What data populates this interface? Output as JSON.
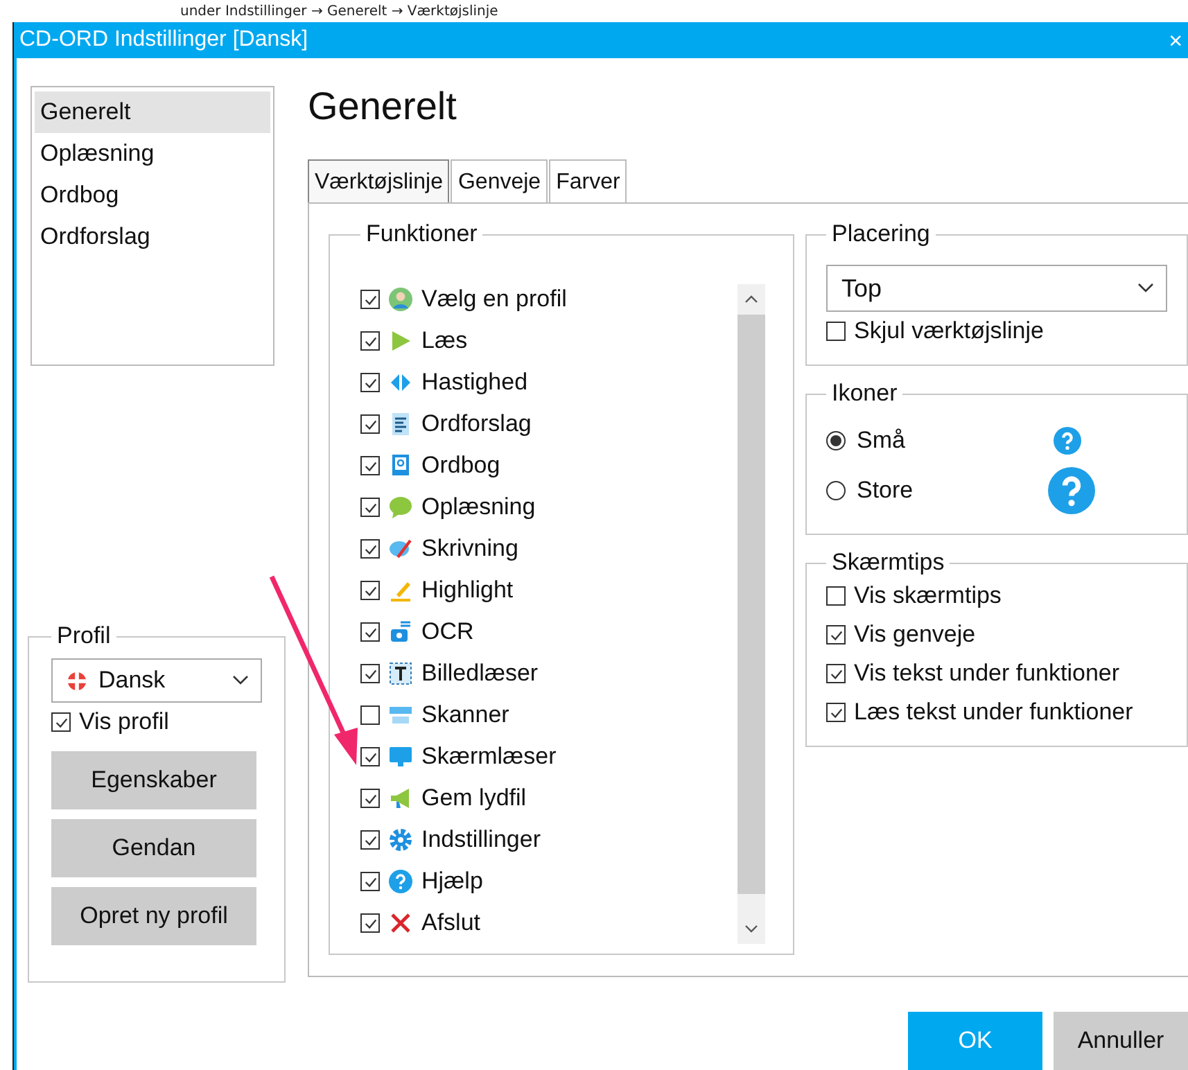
{
  "caption": "under Indstillinger → Generelt → Værktøjslinje",
  "window": {
    "title": "CD-ORD Indstillinger [Dansk]",
    "close": "×"
  },
  "sidebar": {
    "items": [
      {
        "label": "Generelt",
        "selected": true
      },
      {
        "label": "Oplæsning",
        "selected": false
      },
      {
        "label": "Ordbog",
        "selected": false
      },
      {
        "label": "Ordforslag",
        "selected": false
      }
    ]
  },
  "profile": {
    "title": "Profil",
    "language": "Dansk",
    "show_profile": {
      "label": "Vis profil",
      "checked": true
    },
    "buttons": [
      "Egenskaber",
      "Gendan",
      "Opret ny profil"
    ]
  },
  "heading": "Generelt",
  "tabs": [
    {
      "label": "Værktøjslinje",
      "selected": true
    },
    {
      "label": "Genveje",
      "selected": false
    },
    {
      "label": "Farver",
      "selected": false
    }
  ],
  "functions": {
    "title": "Funktioner",
    "items": [
      {
        "label": "Vælg en profil",
        "checked": true
      },
      {
        "label": "Læs",
        "checked": true
      },
      {
        "label": "Hastighed",
        "checked": true
      },
      {
        "label": "Ordforslag",
        "checked": true
      },
      {
        "label": "Ordbog",
        "checked": true
      },
      {
        "label": "Oplæsning",
        "checked": true
      },
      {
        "label": "Skrivning",
        "checked": true
      },
      {
        "label": "Highlight",
        "checked": true
      },
      {
        "label": "OCR",
        "checked": true
      },
      {
        "label": "Billedlæser",
        "checked": true
      },
      {
        "label": "Skanner",
        "checked": false
      },
      {
        "label": "Skærmlæser",
        "checked": true
      },
      {
        "label": "Gem lydfil",
        "checked": true
      },
      {
        "label": "Indstillinger",
        "checked": true
      },
      {
        "label": "Hjælp",
        "checked": true
      },
      {
        "label": "Afslut",
        "checked": true
      }
    ]
  },
  "placement": {
    "title": "Placering",
    "value": "Top",
    "hide_toolbar": {
      "label": "Skjul værktøjslinje",
      "checked": false
    }
  },
  "icons": {
    "title": "Ikoner",
    "options": [
      {
        "label": "Små",
        "selected": true,
        "kind": "small"
      },
      {
        "label": "Store",
        "selected": false,
        "kind": "large"
      }
    ]
  },
  "screentips": {
    "title": "Skærmtips",
    "items": [
      {
        "label": "Vis skærmtips",
        "checked": false
      },
      {
        "label": "Vis genveje",
        "checked": true
      },
      {
        "label": "Vis tekst under funktioner",
        "checked": true
      },
      {
        "label": "Læs tekst under funktioner",
        "checked": true
      }
    ]
  },
  "buttons": [
    {
      "label": "OK",
      "kind": "primary"
    },
    {
      "label": "Annuller",
      "kind": "secondary"
    }
  ]
}
